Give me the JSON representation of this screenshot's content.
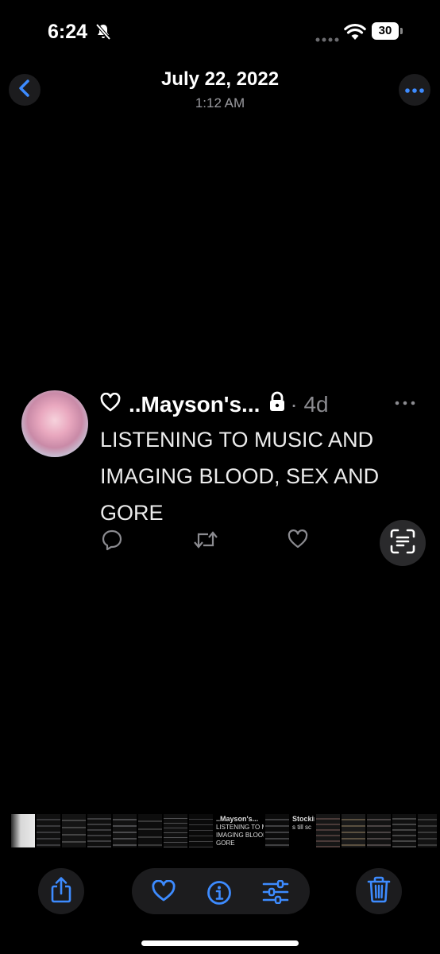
{
  "status_bar": {
    "time": "6:24",
    "battery": "30",
    "icons": [
      "bell-slash-icon",
      "signal-dots-icon",
      "wifi-icon",
      "battery-icon"
    ]
  },
  "header": {
    "date": "July 22, 2022",
    "time": "1:12 AM",
    "icons": [
      "chevron-left-icon",
      "ellipsis-icon"
    ]
  },
  "tweet": {
    "display_name": "..Mayson's...",
    "age": "· 4d",
    "text": "LISTENING TO MUSIC AND IMAGING BLOOD, SEX AND GORE",
    "icons": [
      "heart-outline-icon",
      "lock-icon",
      "more-dots-icon",
      "reply-icon",
      "retweet-icon",
      "like-icon"
    ]
  },
  "filmstrip": {
    "captions": [
      {
        "index": 9,
        "lines": [
          "..Mayson's...",
          "LISTENING TO MU",
          "IMAGING BLOOD, S",
          "GORE"
        ]
      },
      {
        "index": 11,
        "lines": [
          "Stockin",
          "s till sc"
        ]
      }
    ]
  },
  "toolbar": {
    "icons": [
      "share-icon",
      "favorite-heart-icon",
      "info-icon",
      "adjust-sliders-icon",
      "trash-icon"
    ]
  },
  "colors": {
    "accent": "#3d8bff",
    "background": "#000000",
    "button_bg": "#1c1c1e",
    "muted_text": "#8b8b90"
  }
}
